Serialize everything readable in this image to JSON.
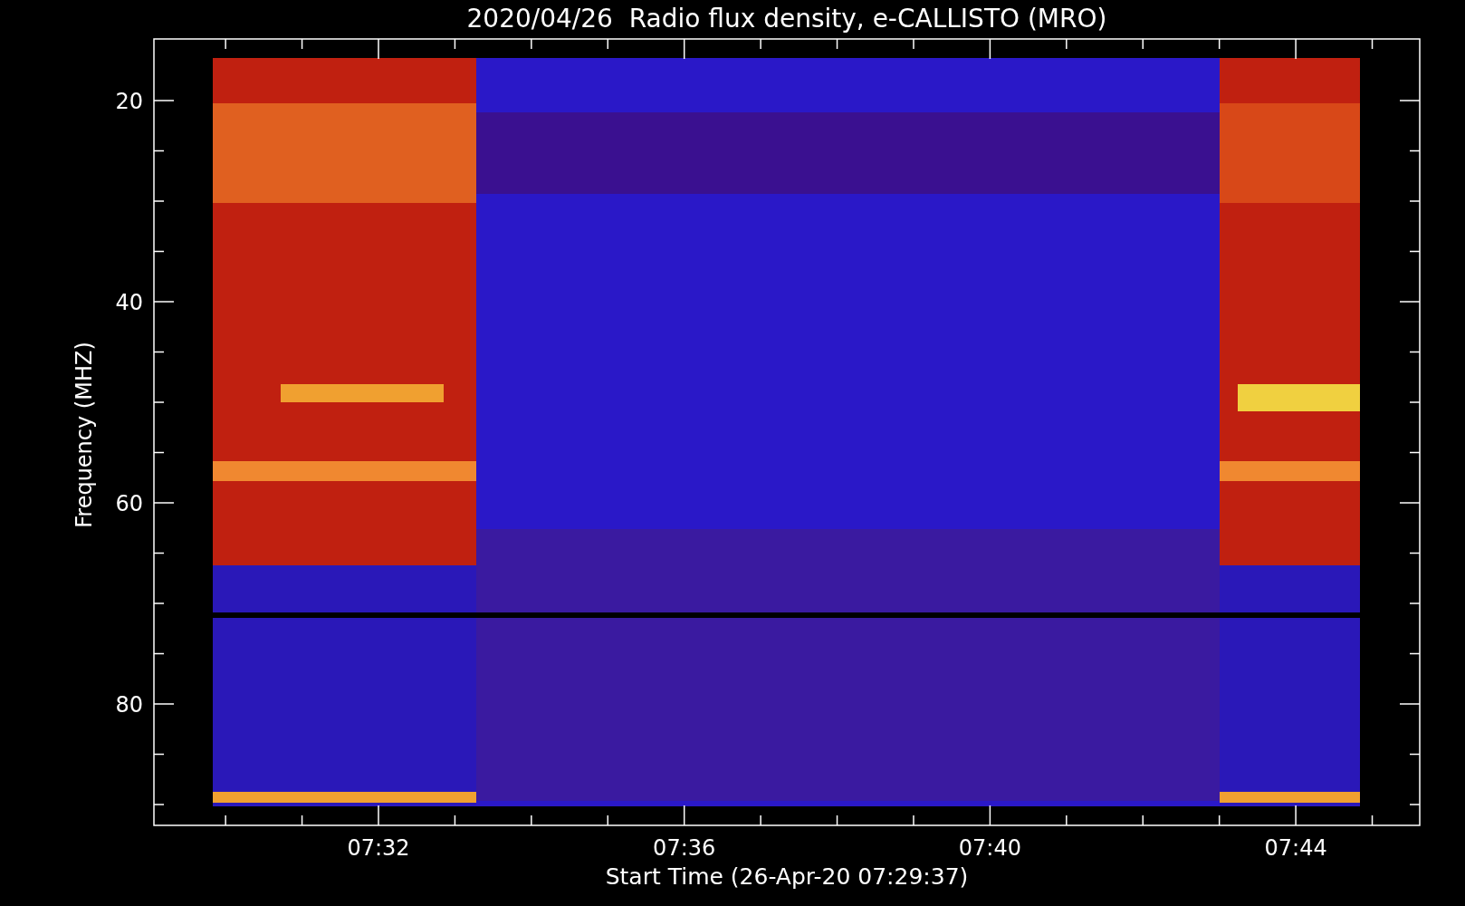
{
  "title": "2020/04/26  Radio flux density, e-CALLISTO (MRO)",
  "y_axis": {
    "label": "Frequency (MHZ)",
    "tick_labels": [
      "20",
      "40",
      "60",
      "80"
    ]
  },
  "x_axis": {
    "label": "Start Time (26-Apr-20 07:29:37)",
    "tick_labels": [
      "07:32",
      "07:36",
      "07:40",
      "07:44"
    ]
  }
}
